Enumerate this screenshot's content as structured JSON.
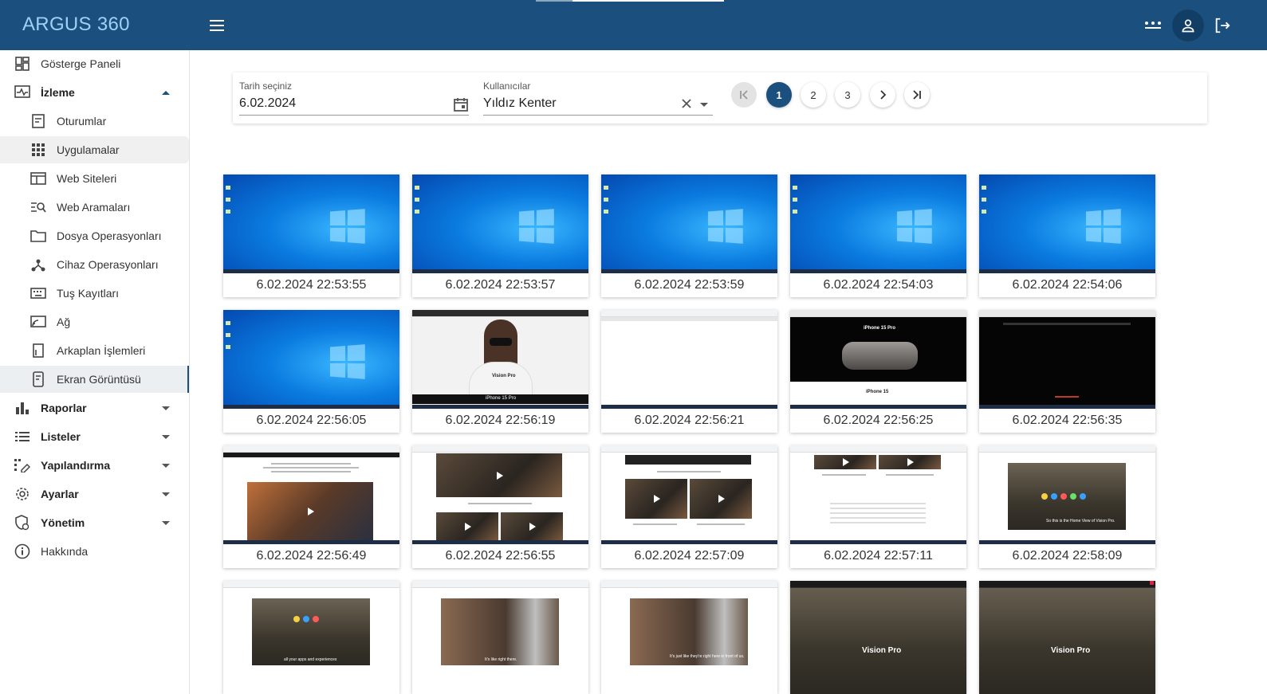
{
  "header": {
    "brand": "ARGUS 360"
  },
  "sidebar": {
    "items": [
      {
        "label": "Gösterge Paneli",
        "icon": "dashboard-icon"
      },
      {
        "label": "İzleme",
        "icon": "monitoring-icon",
        "expanded": true
      },
      {
        "label": "Oturumlar",
        "icon": "sessions-icon"
      },
      {
        "label": "Uygulamalar",
        "icon": "apps-icon"
      },
      {
        "label": "Web Siteleri",
        "icon": "websites-icon"
      },
      {
        "label": "Web Aramaları",
        "icon": "web-search-icon"
      },
      {
        "label": "Dosya Operasyonları",
        "icon": "folder-icon"
      },
      {
        "label": "Cihaz Operasyonları",
        "icon": "device-icon"
      },
      {
        "label": "Tuş Kayıtları",
        "icon": "keyboard-icon"
      },
      {
        "label": "Ağ",
        "icon": "network-icon"
      },
      {
        "label": "Arkaplan İşlemleri",
        "icon": "background-process-icon"
      },
      {
        "label": "Ekran Görüntüsü",
        "icon": "screenshot-icon",
        "active": true
      },
      {
        "label": "Raporlar",
        "icon": "reports-icon"
      },
      {
        "label": "Listeler",
        "icon": "lists-icon"
      },
      {
        "label": "Yapılandırma",
        "icon": "configuration-icon"
      },
      {
        "label": "Ayarlar",
        "icon": "settings-icon"
      },
      {
        "label": "Yönetim",
        "icon": "management-icon"
      },
      {
        "label": "Hakkında",
        "icon": "info-icon"
      }
    ]
  },
  "filters": {
    "date_label": "Tarih seçiniz",
    "date_value": "6.02.2024",
    "users_label": "Kullanıcılar",
    "users_value": "Yıldız Kenter"
  },
  "pagination": {
    "pages": [
      "1",
      "2",
      "3"
    ],
    "current": "1"
  },
  "screenshots": [
    {
      "timestamp": "6.02.2024 22:53:55",
      "kind": "desktop"
    },
    {
      "timestamp": "6.02.2024 22:53:57",
      "kind": "desktop"
    },
    {
      "timestamp": "6.02.2024 22:53:59",
      "kind": "desktop"
    },
    {
      "timestamp": "6.02.2024 22:54:03",
      "kind": "desktop"
    },
    {
      "timestamp": "6.02.2024 22:54:06",
      "kind": "desktop"
    },
    {
      "timestamp": "6.02.2024 22:56:05",
      "kind": "desktop"
    },
    {
      "timestamp": "6.02.2024 22:56:19",
      "kind": "vision-pro-hero"
    },
    {
      "timestamp": "6.02.2024 22:56:21",
      "kind": "blank-web"
    },
    {
      "timestamp": "6.02.2024 22:56:25",
      "kind": "iphone-dark"
    },
    {
      "timestamp": "6.02.2024 22:56:35",
      "kind": "dark-web"
    },
    {
      "timestamp": "6.02.2024 22:56:49",
      "kind": "web-video"
    },
    {
      "timestamp": "6.02.2024 22:56:55",
      "kind": "web-videos"
    },
    {
      "timestamp": "6.02.2024 22:57:09",
      "kind": "web-videos"
    },
    {
      "timestamp": "6.02.2024 22:57:11",
      "kind": "web-text"
    },
    {
      "timestamp": "6.02.2024 22:58:09",
      "kind": "web-room"
    },
    {
      "timestamp": "",
      "kind": "web-room"
    },
    {
      "timestamp": "",
      "kind": "web-people"
    },
    {
      "timestamp": "",
      "kind": "web-people"
    },
    {
      "timestamp": "",
      "kind": "room-dark"
    },
    {
      "timestamp": "",
      "kind": "room-dark"
    }
  ],
  "thumb_text": {
    "vision_pro": "Vision Pro",
    "iphone15pro": "iPhone 15 Pro",
    "iphone15": "iPhone 15",
    "guided_tour": "Vision Pro",
    "home_view": "So this is the Home View of Vision Pro.",
    "apps_caption": "all your apps and experiences",
    "like_right_there": "It's like right there.",
    "right_here": "It's just like they're right here in front of us."
  },
  "colors": {
    "header_bg": "#1b4f7e",
    "brand_text": "#9fd0f5",
    "accent": "#1b4f7e"
  }
}
